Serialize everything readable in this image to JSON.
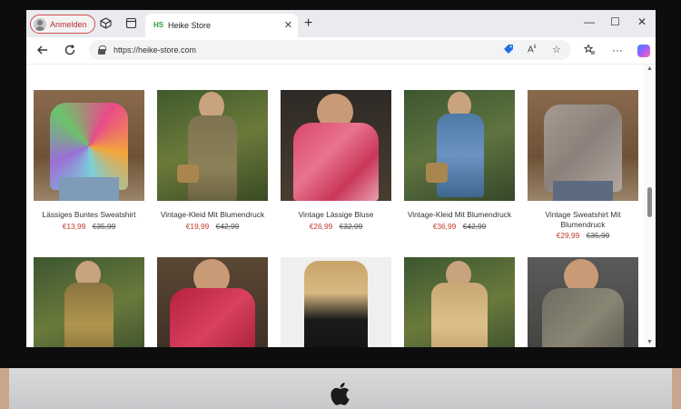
{
  "browser": {
    "profile_label": "Anmelden",
    "tab_title": "Heike Store",
    "tab_favicon": "HS",
    "url": "https://heike-store.com"
  },
  "icons": {
    "workspaces": "workspaces-icon",
    "tab_actions": "tab-actions-icon",
    "back": "back-arrow-icon",
    "refresh": "refresh-icon",
    "lock": "lock-icon",
    "coupon": "tag-icon",
    "read_aloud": "read-aloud-icon",
    "favorite": "star-icon",
    "favorites": "favorites-icon",
    "more": "more-icon",
    "copilot": "copilot-icon",
    "apple": "apple-logo"
  },
  "colors": {
    "price_red": "#c0392b",
    "profile_red": "#d04a4a",
    "favicon_green": "#2e9a3a"
  },
  "products": [
    {
      "name": "Lässiges Buntes Sweatshirt",
      "price": "€13,99",
      "old_price": "€35,99"
    },
    {
      "name": "Vintage-Kleid Mit Blumendruck",
      "price": "€19,99",
      "old_price": "€42,99"
    },
    {
      "name": "Vintage Lässige Bluse",
      "price": "€26,99",
      "old_price": "€32,99"
    },
    {
      "name": "Vintage-Kleid Mit Blumendruck",
      "price": "€36,99",
      "old_price": "€42,99"
    },
    {
      "name": "Vintage Sweatshirt Mit Blumendruck",
      "price": "€29,99",
      "old_price": "€35,99"
    }
  ]
}
